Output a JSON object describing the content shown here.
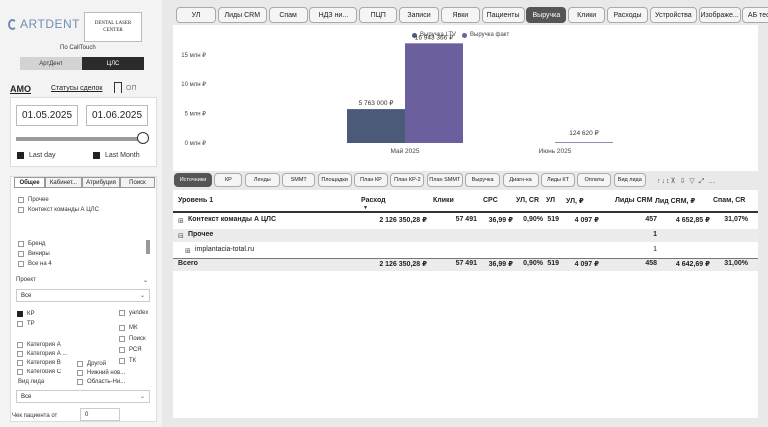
{
  "brand": {
    "logo_text": "ARTDENT",
    "clinic_line1": "DENTAL LASER",
    "clinic_line2": "CENTER",
    "subtitle": "По CallTouch"
  },
  "segment": {
    "options": [
      "АртДент",
      "ЦЛС"
    ],
    "selected": "ЦЛС"
  },
  "links": {
    "amo": "АМО",
    "status": "Статусы сделок",
    "op": "ОП"
  },
  "dates": {
    "from": "01.05.2025",
    "to": "01.06.2025"
  },
  "period_checks": {
    "last_day": "Last day",
    "last_month": "Last Month"
  },
  "filter_tabs": [
    "Общее",
    "Кабинет...",
    "Атрибуция",
    "Поиск"
  ],
  "filters": {
    "top_items": [
      "Прочее",
      "Контекст команды А ЦЛС"
    ],
    "mid_items": [
      "Бренд",
      "Виниры",
      "Все на 4"
    ],
    "project_label": "Проект",
    "project_value": "Все",
    "col1": [
      "КР",
      "ТР"
    ],
    "col2": [
      "yandex",
      "МК",
      "Поиск",
      "РСЯ",
      "ТК"
    ],
    "categories": [
      "Категория А",
      "Категория А ...",
      "Категория В",
      "Категория С"
    ],
    "others": [
      "Другой",
      "Нижний нов...",
      "Область-Ни..."
    ],
    "lead_label": "Вид лида",
    "lead_value": "Все",
    "check_label": "Чек пациента от",
    "check_value": "0"
  },
  "top_tabs": [
    "УЛ",
    "Лиды CRM",
    "Спам",
    "НДЗ ни...",
    "ПЦП",
    "Записи",
    "Явки",
    "Пациенты",
    "Выручка",
    "Клики",
    "Расходы",
    "Устройства",
    "Изображе...",
    "АБ тесты"
  ],
  "active_top_tab": "Выручка",
  "chart_data": {
    "type": "bar",
    "categories": [
      "Май 2025",
      "Июнь 2025"
    ],
    "series": [
      {
        "name": "Выручка LTV",
        "values": [
          5763000,
          0
        ],
        "labels": [
          "5 763 000 ₽",
          ""
        ]
      },
      {
        "name": "Выручка факт",
        "values": [
          16943366,
          124620
        ],
        "labels": [
          "16 943 366 ₽",
          "124 620 ₽"
        ]
      }
    ],
    "ylim": [
      0,
      17000000
    ],
    "yticks": [
      0,
      5000000,
      10000000,
      15000000
    ],
    "ytick_labels": [
      "0 млн ₽",
      "5 млн ₽",
      "10 млн ₽",
      "15 млн ₽"
    ],
    "colors": {
      "Выручка LTV": "#4a5a78",
      "Выручка факт": "#6c5f9d"
    },
    "legend": "top-center",
    "grid": false
  },
  "sub_tabs": [
    "Источники",
    "КР",
    "Ленды",
    "SMMT",
    "Площадки",
    "План КР",
    "План КР-2",
    "План SMMT",
    "Выручка",
    "Диагн-ка",
    "Лиды КТ",
    "Оплаты",
    "Вид лида"
  ],
  "active_sub_tab": "Источники",
  "table": {
    "headers": [
      "Уровень 1",
      "Расход",
      "Клики",
      "CPC",
      "УЛ, CR",
      "УЛ",
      "УЛ, ₽",
      "Лиды CRM",
      "Лид CRM, ₽",
      "Спам, CR"
    ],
    "rows": [
      {
        "name": "Контекст команды А ЦЛС",
        "bold": true,
        "expand": "+",
        "values": [
          "2 126 350,28 ₽",
          "57 491",
          "36,99 ₽",
          "0,90%",
          "519",
          "4 097 ₽",
          "457",
          "4 652,85 ₽",
          "31,07%"
        ]
      },
      {
        "name": "Прочее",
        "bold": true,
        "expand": "−",
        "values": [
          "",
          "",
          "",
          "",
          "",
          "",
          "1",
          "",
          ""
        ]
      },
      {
        "name": "implantacia-total.ru",
        "bold": false,
        "expand": "+",
        "values": [
          "",
          "",
          "",
          "",
          "",
          "",
          "1",
          "",
          ""
        ]
      },
      {
        "name": "Всего",
        "bold": true,
        "expand": "",
        "values": [
          "2 126 350,28 ₽",
          "57 491",
          "36,99 ₽",
          "0,90%",
          "519",
          "4 097 ₽",
          "458",
          "4 642,69 ₽",
          "31,00%"
        ]
      }
    ]
  }
}
